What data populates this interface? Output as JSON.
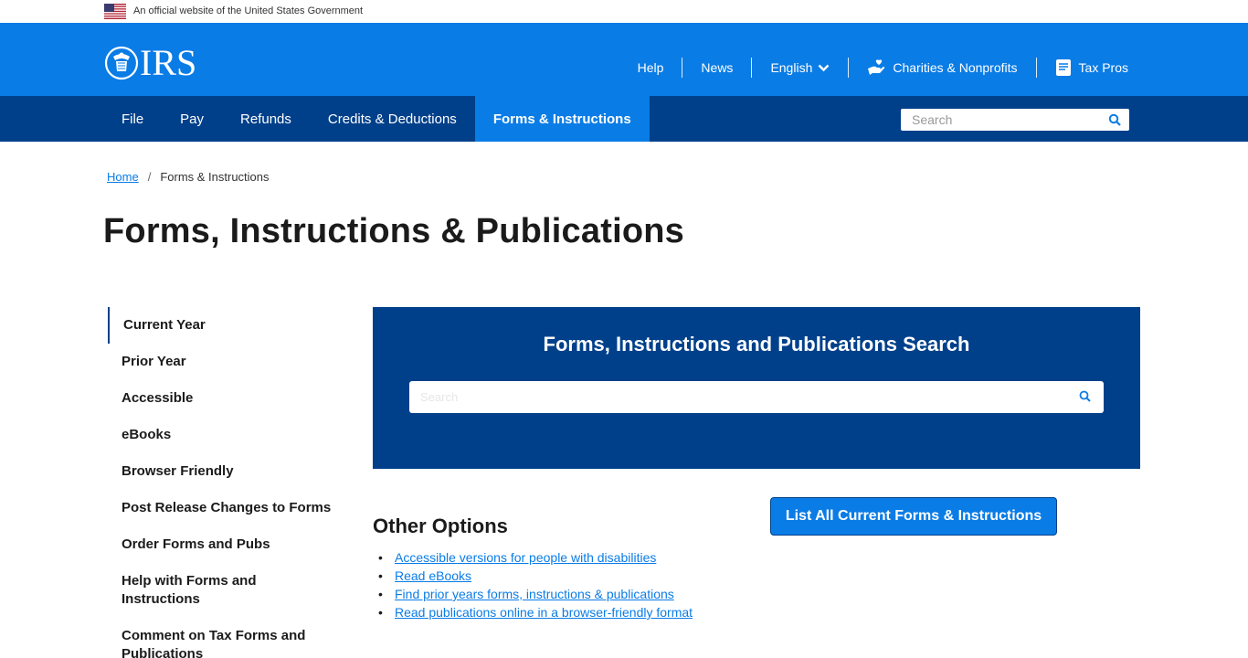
{
  "gov_banner": {
    "text": "An official website of the United States Government",
    "flag_icon": "us-flag-icon"
  },
  "header": {
    "logo_text": "IRS",
    "logo_icon": "irs-eagle-icon",
    "utility_nav": [
      {
        "label": "Help"
      },
      {
        "label": "News"
      },
      {
        "label": "English",
        "icon": "chevron-down-icon"
      },
      {
        "label": "Charities & Nonprofits",
        "icon": "charity-hand-icon"
      },
      {
        "label": "Tax Pros",
        "icon": "document-icon"
      }
    ]
  },
  "main_nav": {
    "items": [
      {
        "label": "File"
      },
      {
        "label": "Pay"
      },
      {
        "label": "Refunds"
      },
      {
        "label": "Credits & Deductions"
      },
      {
        "label": "Forms & Instructions",
        "active": true
      }
    ],
    "search": {
      "placeholder": "Search",
      "icon": "search-icon"
    }
  },
  "breadcrumb": {
    "home": "Home",
    "separator": "/",
    "current": "Forms & Instructions"
  },
  "page_title": "Forms, Instructions & Publications",
  "sidebar": {
    "items": [
      {
        "label": "Current Year",
        "current": true
      },
      {
        "label": "Prior Year"
      },
      {
        "label": "Accessible"
      },
      {
        "label": "eBooks"
      },
      {
        "label": "Browser Friendly"
      },
      {
        "label": "Post Release Changes to Forms"
      },
      {
        "label": "Order Forms and Pubs"
      },
      {
        "label": "Help with Forms and Instructions"
      },
      {
        "label": "Comment on Tax Forms and Publications"
      }
    ]
  },
  "search_panel": {
    "title": "Forms, Instructions and Publications Search",
    "placeholder": "Search",
    "icon": "search-icon"
  },
  "other_options": {
    "title": "Other Options",
    "links": [
      "Accessible versions for people with disabilities",
      "Read eBooks",
      "Find prior years forms, instructions & publications",
      "Read publications online in a browser-friendly format"
    ]
  },
  "list_all_button": {
    "label": "List All Current Forms & Instructions"
  },
  "colors": {
    "primary_blue": "#0a7ce6",
    "dark_blue": "#00408a",
    "text": "#1b1b1b"
  }
}
